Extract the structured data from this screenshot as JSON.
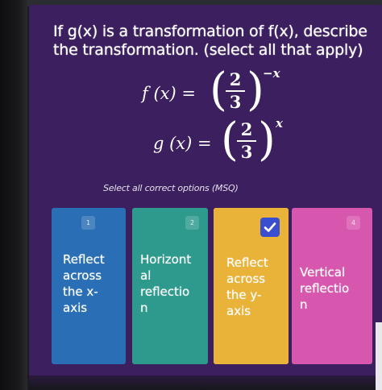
{
  "question": {
    "text": "If g(x) is a transformation of f(x), describe the transformation. (select all that apply)"
  },
  "equations": {
    "f": {
      "lhs": "f (x) =",
      "numerator": "2",
      "denominator": "3",
      "exponent": "−x"
    },
    "g": {
      "lhs": "g (x) =",
      "numerator": "2",
      "denominator": "3",
      "exponent": "x"
    }
  },
  "instruction": "Select all correct options (MSQ)",
  "options": [
    {
      "number": "1",
      "label": "Reflect\nacross\nthe x-\naxis",
      "color": "#2a6fb5",
      "selected": false
    },
    {
      "number": "2",
      "label": "Horizont\nal\nreflectio\nn",
      "color": "#2e9a8e",
      "selected": false
    },
    {
      "number": "3",
      "label": "Reflect\nacross\nthe y-\naxis",
      "color": "#e9b238",
      "selected": true
    },
    {
      "number": "4",
      "label": "Vertical\nreflectio\nn",
      "color": "#d857ae",
      "selected": false
    }
  ],
  "icons": {
    "selected_check": "checkmark-icon"
  }
}
